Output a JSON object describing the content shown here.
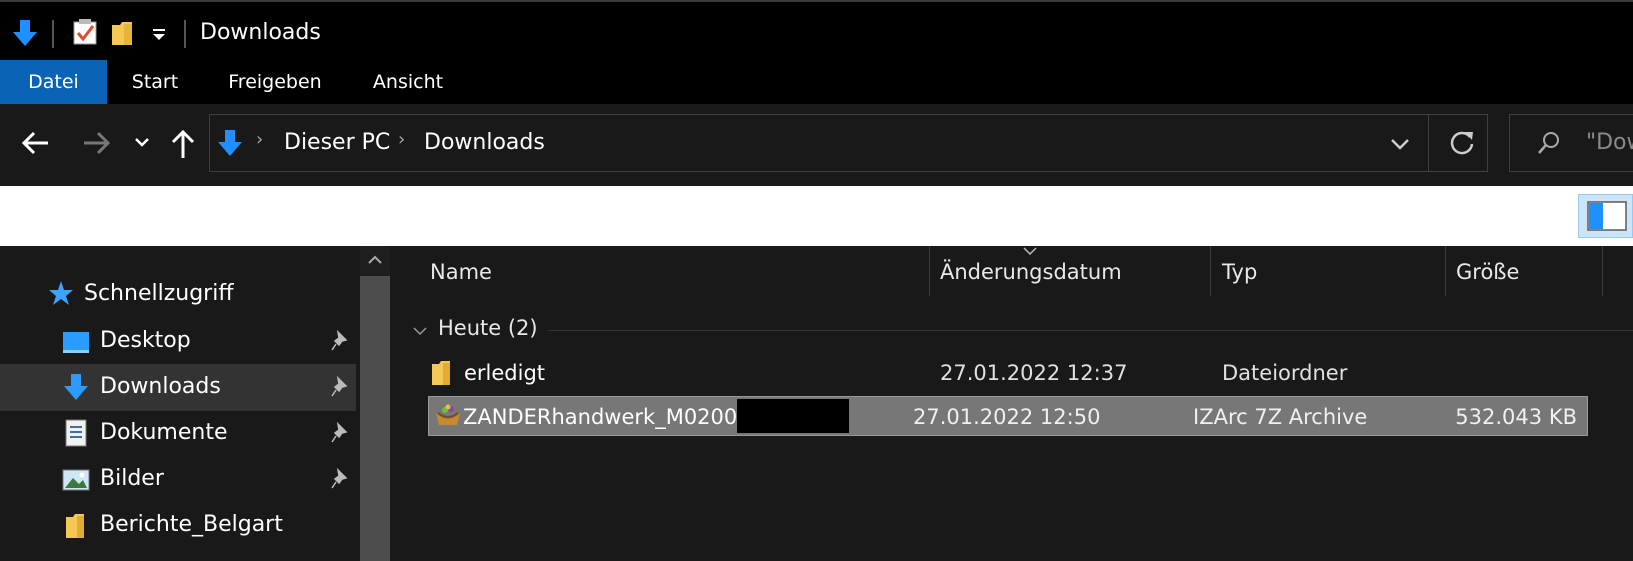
{
  "window": {
    "title": "Downloads"
  },
  "ribbon": {
    "tabs": [
      "Datei",
      "Start",
      "Freigeben",
      "Ansicht"
    ]
  },
  "address_bar": {
    "crumbs": [
      "Dieser PC",
      "Downloads"
    ]
  },
  "search": {
    "placeholder": "\"Dow"
  },
  "nav_pane": {
    "quick_access_label": "Schnellzugriff",
    "items": [
      {
        "label": "Desktop",
        "icon": "desktop-icon",
        "pinned": true
      },
      {
        "label": "Downloads",
        "icon": "download-icon",
        "pinned": true,
        "selected": true
      },
      {
        "label": "Dokumente",
        "icon": "document-icon",
        "pinned": true
      },
      {
        "label": "Bilder",
        "icon": "pictures-icon",
        "pinned": true
      },
      {
        "label": "Berichte_Belgart",
        "icon": "folder-icon",
        "pinned": false
      }
    ]
  },
  "file_list": {
    "columns": [
      "Name",
      "Änderungsdatum",
      "Typ",
      "Größe"
    ],
    "group_label": "Heute (2)",
    "rows": [
      {
        "name": "erledigt",
        "date": "27.01.2022 12:37",
        "type": "Dateiordner",
        "size": "",
        "icon": "folder-icon",
        "selected": false
      },
      {
        "name": "ZANDERhandwerk_M0200_",
        "date": "27.01.2022 12:50",
        "type": "IZArc 7Z Archive",
        "size": "532.043 KB",
        "icon": "archive-icon",
        "selected": true
      }
    ]
  },
  "colors": {
    "accent": "#0a63b5",
    "background": "#191919",
    "selected_row": "#777777"
  }
}
